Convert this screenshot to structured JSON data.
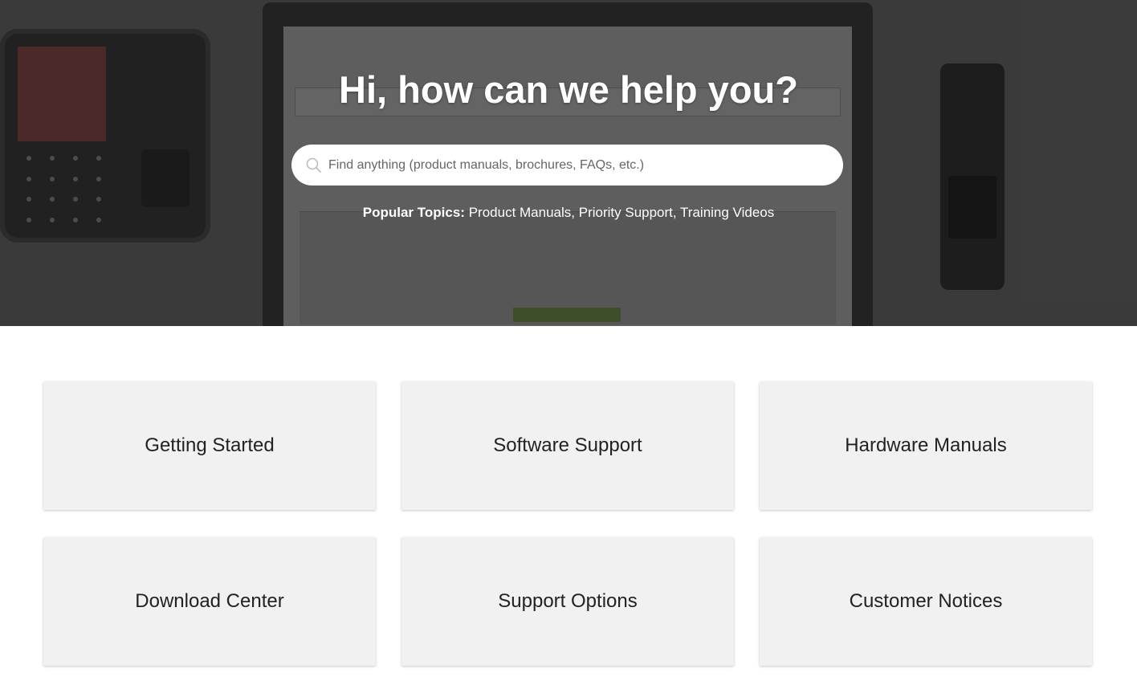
{
  "hero": {
    "title": "Hi, how can we help you?",
    "search": {
      "placeholder": "Find anything (product manuals, brochures, FAQs, etc.)",
      "value": ""
    },
    "popular": {
      "label": "Popular Topics:",
      "links": [
        "Product Manuals",
        "Priority Support",
        "Training Videos"
      ]
    }
  },
  "cards": [
    {
      "label": "Getting Started"
    },
    {
      "label": "Software Support"
    },
    {
      "label": "Hardware Manuals"
    },
    {
      "label": "Download Center"
    },
    {
      "label": "Support Options"
    },
    {
      "label": "Customer Notices"
    }
  ]
}
